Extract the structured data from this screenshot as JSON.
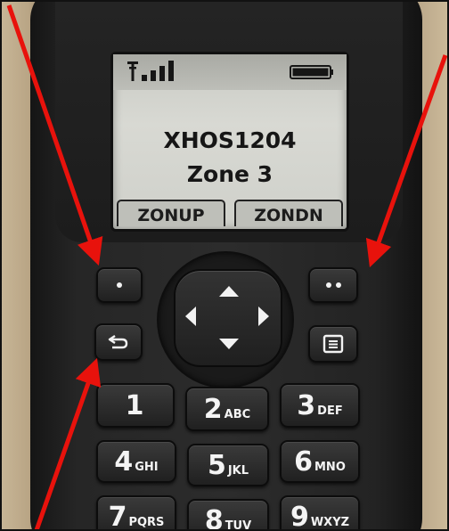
{
  "display": {
    "line1": "XHOS1204",
    "line2": "Zone 3",
    "softkey_left": "ZONUP",
    "softkey_right": "ZONDN"
  },
  "keypad": {
    "k1": {
      "digit": "1",
      "letters": ""
    },
    "k2": {
      "digit": "2",
      "letters": "ABC"
    },
    "k3": {
      "digit": "3",
      "letters": "DEF"
    },
    "k4": {
      "digit": "4",
      "letters": "GHI"
    },
    "k5": {
      "digit": "5",
      "letters": "JKL"
    },
    "k6": {
      "digit": "6",
      "letters": "MNO"
    },
    "k7": {
      "digit": "7",
      "letters": "PQRS"
    },
    "k8": {
      "digit": "8",
      "letters": "TUV"
    },
    "k9": {
      "digit": "9",
      "letters": "WXYZ"
    }
  },
  "icons": {
    "signal": "signal-strength-icon",
    "battery": "battery-icon",
    "back": "back-arrow-icon",
    "menu": "menu-icon"
  },
  "colors": {
    "annotation_arrow": "#e8120c",
    "screen_background": "#d3d4ce",
    "radio_body": "#262626"
  }
}
